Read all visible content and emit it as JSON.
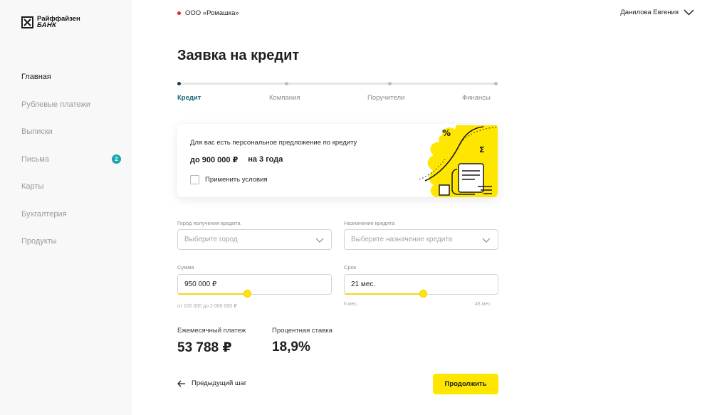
{
  "brand": {
    "line1": "Райффайзен",
    "line2": "БАНК"
  },
  "sidebar": {
    "items": [
      {
        "label": "Главная"
      },
      {
        "label": "Рублевые платежи"
      },
      {
        "label": "Выписки"
      },
      {
        "label": "Письма",
        "badge": "2"
      },
      {
        "label": "Карты"
      },
      {
        "label": "Бухгалтерия"
      },
      {
        "label": "Продукты"
      }
    ]
  },
  "header": {
    "org": "ООО «Ромашка»",
    "user": "Данилова Евгения"
  },
  "page": {
    "title": "Заявка на кредит"
  },
  "stepper": {
    "steps": [
      {
        "label": "Кредит",
        "active": true
      },
      {
        "label": "Компания"
      },
      {
        "label": "Поручители"
      },
      {
        "label": "Финансы"
      }
    ]
  },
  "offer": {
    "text": "Для вас есть персональное предложение по кредиту",
    "amount": "до 900 000 ₽",
    "term": "на 3 года",
    "apply_label": "Применить условия"
  },
  "form": {
    "city": {
      "label": "Город получения кредита",
      "placeholder": "Выберите город"
    },
    "purpose": {
      "label": "Назначение кредита",
      "placeholder": "Выберите назначение кредита"
    },
    "sum": {
      "label": "Сумма",
      "value": "950 000 ₽",
      "hint": "от 100 000 до 2 000 000 ₽",
      "fraction": 0.45
    },
    "term": {
      "label": "Срок",
      "value": "21 мес.",
      "min_hint": "6 мес.",
      "max_hint": "48 мес.",
      "fraction": 0.51
    }
  },
  "results": {
    "payment_label": "Ежемесячный платеж",
    "payment_value": "53 788 ₽",
    "rate_label": "Процентная ставка",
    "rate_value": "18,9%"
  },
  "actions": {
    "back_label": "Предыдущий шаг",
    "continue_label": "Продолжить"
  },
  "colors": {
    "accent": "#fee600",
    "active_step": "#1b6a7a",
    "badge": "#1aa5b3",
    "org_dot": "#e3213a"
  }
}
